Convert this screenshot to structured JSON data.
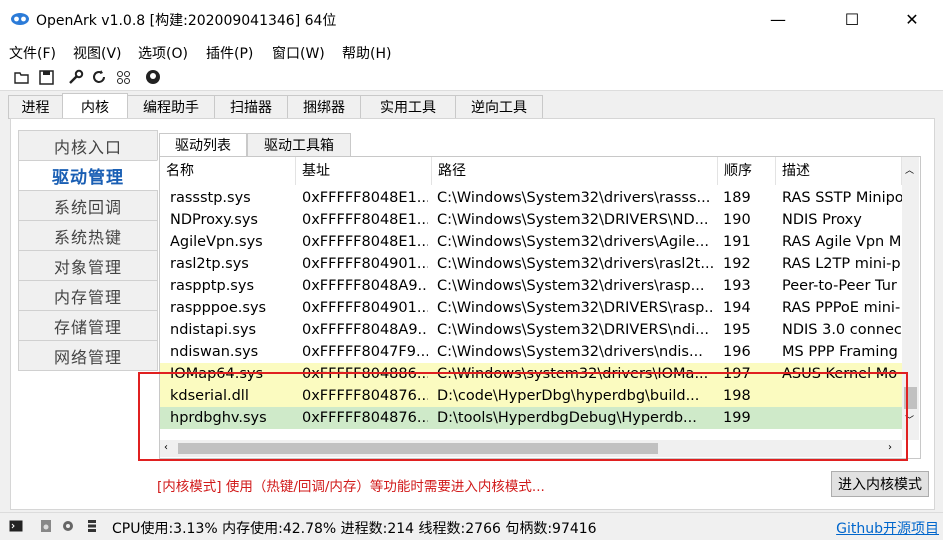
{
  "window": {
    "title": "OpenArk v1.0.8  [构建:202009041346]  64位",
    "minimize": "—",
    "maximize": "☐",
    "close": "✕"
  },
  "menu": [
    "文件(F)",
    "视图(V)",
    "选项(O)",
    "插件(P)",
    "窗口(W)",
    "帮助(H)"
  ],
  "toolbar_icons": [
    "open-folder-icon",
    "save-icon",
    "wrench-icon",
    "refresh-icon",
    "grid-icon",
    "github-icon"
  ],
  "main_tabs": [
    "进程",
    "内核",
    "编程助手",
    "扫描器",
    "捆绑器",
    "实用工具",
    "逆向工具"
  ],
  "nav": [
    "内核入口",
    "驱动管理",
    "系统回调",
    "系统热键",
    "对象管理",
    "内存管理",
    "存储管理",
    "网络管理"
  ],
  "sub_tabs": [
    "驱动列表",
    "驱动工具箱"
  ],
  "table": {
    "headers": [
      "名称",
      "基址",
      "路径",
      "顺序",
      "描述"
    ],
    "rows": [
      {
        "name": "rassstp.sys",
        "base": "0xFFFFF8048E1...",
        "path": "C:\\Windows\\System32\\drivers\\rasss...",
        "order": "189",
        "desc": "RAS SSTP Minipo",
        "hl": ""
      },
      {
        "name": "NDProxy.sys",
        "base": "0xFFFFF8048E1...",
        "path": "C:\\Windows\\System32\\DRIVERS\\ND...",
        "order": "190",
        "desc": "NDIS Proxy",
        "hl": ""
      },
      {
        "name": "AgileVpn.sys",
        "base": "0xFFFFF8048E1...",
        "path": "C:\\Windows\\System32\\drivers\\Agile...",
        "order": "191",
        "desc": "RAS Agile Vpn M",
        "hl": ""
      },
      {
        "name": "rasl2tp.sys",
        "base": "0xFFFFF804901...",
        "path": "C:\\Windows\\System32\\drivers\\rasl2t...",
        "order": "192",
        "desc": "RAS L2TP mini-p",
        "hl": ""
      },
      {
        "name": "raspptp.sys",
        "base": "0xFFFFF8048A9...",
        "path": "C:\\Windows\\System32\\drivers\\rasp...",
        "order": "193",
        "desc": "Peer-to-Peer Tur",
        "hl": ""
      },
      {
        "name": "raspppoe.sys",
        "base": "0xFFFFF804901...",
        "path": "C:\\Windows\\System32\\DRIVERS\\rasp...",
        "order": "194",
        "desc": "RAS PPPoE mini-",
        "hl": ""
      },
      {
        "name": "ndistapi.sys",
        "base": "0xFFFFF8048A9...",
        "path": "C:\\Windows\\System32\\DRIVERS\\ndi...",
        "order": "195",
        "desc": "NDIS 3.0 connec",
        "hl": ""
      },
      {
        "name": "ndiswan.sys",
        "base": "0xFFFFF8047F9...",
        "path": "C:\\Windows\\System32\\drivers\\ndis...",
        "order": "196",
        "desc": "MS PPP Framing",
        "hl": ""
      },
      {
        "name": "IOMap64.sys",
        "base": "0xFFFFF804886...",
        "path": "C:\\Windows\\system32\\drivers\\IOMa...",
        "order": "197",
        "desc": "ASUS Kernel Mo",
        "hl": "yellow"
      },
      {
        "name": "kdserial.dll",
        "base": "0xFFFFF804876...",
        "path": "D:\\code\\HyperDbg\\hyperdbg\\build...",
        "order": "198",
        "desc": "",
        "hl": "yellow"
      },
      {
        "name": "hprdbghv.sys",
        "base": "0xFFFFF804876...",
        "path": "D:\\tools\\HyperdbgDebug\\Hyperdb...",
        "order": "199",
        "desc": "",
        "hl": "green"
      }
    ]
  },
  "kernel_message": "[内核模式] 使用（热键/回调/内存）等功能时需要进入内核模式...",
  "enter_kernel_button": "进入内核模式",
  "status": {
    "text": "CPU使用:3.13%  内存使用:42.78%  进程数:214  线程数:2766  句柄数:97416",
    "link": "Github开源项目"
  },
  "colors": {
    "highlight_yellow": "#fbfbc0",
    "highlight_green": "#cfeac9",
    "red_box": "#e02020",
    "accent_blue": "#1a5fb4"
  }
}
